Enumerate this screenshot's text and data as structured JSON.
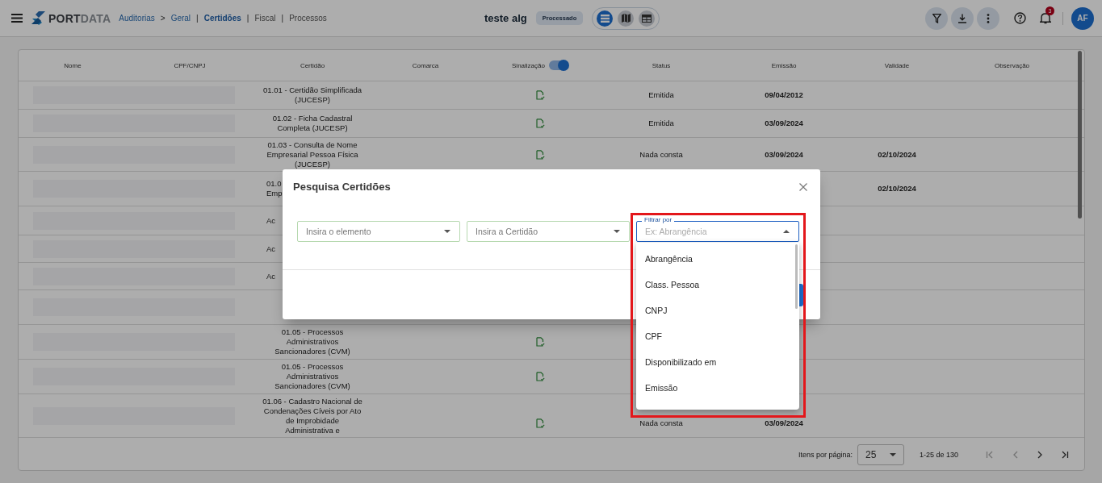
{
  "topbar": {
    "logo": {
      "strong": "PORT",
      "light": "DATA"
    },
    "nav": [
      {
        "kind": "link",
        "label": "Auditorias"
      },
      {
        "kind": "separator",
        "label": ">"
      },
      {
        "kind": "link",
        "label": "Geral"
      },
      {
        "kind": "separator",
        "label": "|"
      },
      {
        "kind": "tab",
        "label": "Certidões",
        "selected": true
      },
      {
        "kind": "separator",
        "label": "|"
      },
      {
        "kind": "tab",
        "label": "Fiscal",
        "selected": false
      },
      {
        "kind": "separator",
        "label": "|"
      },
      {
        "kind": "tab",
        "label": "Processos",
        "selected": false
      }
    ],
    "title": "teste alg",
    "status_badge": "Processado",
    "views": [
      {
        "kind": "list",
        "selected": true
      },
      {
        "kind": "map",
        "selected": false
      },
      {
        "kind": "grid",
        "selected": false
      }
    ],
    "notifications": "3",
    "avatar": "AF"
  },
  "table": {
    "columns": [
      {
        "label": "Nome"
      },
      {
        "label": "CPF/CNPJ"
      },
      {
        "label": "Certidão"
      },
      {
        "label": "Comarca"
      },
      {
        "label": "Sinalização",
        "toggle_on": true
      },
      {
        "label": "Status"
      },
      {
        "label": "Emissão"
      },
      {
        "label": "Validade"
      },
      {
        "label": "Observação"
      }
    ],
    "rows": [
      {
        "certidao": "01.01 - Certidão Simplificada\n(JUCESP)",
        "cert_cut": false,
        "signal": true,
        "status": "Emitida",
        "emissao": "09/04/2012"
      },
      {
        "certidao": "01.02 - Ficha Cadastral\nCompleta (JUCESP)",
        "cert_cut": false,
        "signal": true,
        "status": "Emitida",
        "emissao": "03/09/2024"
      },
      {
        "certidao": "01.03 - Consulta de Nome\nEmpresarial Pessoa Física\n(JUCESP)",
        "cert_cut": false,
        "signal": true,
        "status": "Nada consta",
        "emissao": "03/09/2024",
        "validade": "02/10/2024"
      },
      {
        "certidao": "01.0\nEmp",
        "cert_cut": true,
        "signal": false,
        "validade": "02/10/2024"
      },
      {
        "certidao": "Ac",
        "cert_cut": true,
        "signal": false
      },
      {
        "certidao": "Ac",
        "cert_cut": true,
        "signal": false
      },
      {
        "certidao": "Ac",
        "cert_cut": true,
        "signal": false
      },
      {
        "signal": false
      },
      {
        "certidao": "01.05 - Processos\nAdministrativos\nSancionadores (CVM)",
        "cert_cut": false,
        "signal": true
      },
      {
        "certidao": "01.05 - Processos\nAdministrativos\nSancionadores (CVM)",
        "cert_cut": false,
        "signal": true
      },
      {
        "certidao": "01.06 - Cadastro Nacional de\nCondenações Cíveis por Ato\nde Improbidade\nAdministrativa e",
        "cert_cut": false,
        "signal": true,
        "status": "Nada consta",
        "emissao": "03/09/2024"
      }
    ]
  },
  "pagination": {
    "page_size_label": "Itens por página:",
    "page_size": "25",
    "range": "1-25 de 130",
    "first_disabled": true,
    "prev_disabled": true,
    "next_disabled": false,
    "last_disabled": false
  },
  "modal": {
    "title": "Pesquisa Certidões",
    "fields": [
      {
        "placeholder": "Insira o elemento",
        "open": false
      },
      {
        "placeholder": "Insira a Certidão",
        "open": false
      },
      {
        "label": "Filtrar por",
        "placeholder": "Ex: Abrangência",
        "open": true
      }
    ],
    "options": [
      "Abrangência",
      "Class. Pessoa",
      "CNPJ",
      "CPF",
      "Disponibilizado em",
      "Emissão"
    ]
  }
}
